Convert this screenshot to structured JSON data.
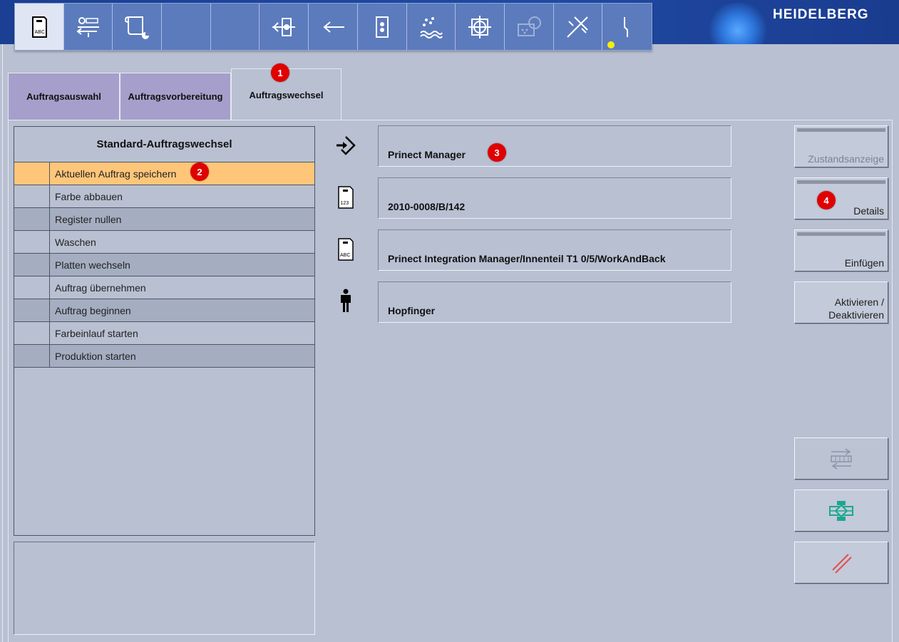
{
  "brand": "HEIDELBERG",
  "toolbar": {
    "buttons": [
      {
        "name": "job-card-abc-icon",
        "active": true
      },
      {
        "name": "feeder-settings-icon",
        "active": false
      },
      {
        "name": "scroll-document-icon",
        "active": false
      },
      {
        "name": "empty-slot-1",
        "active": false
      },
      {
        "name": "empty-slot-2",
        "active": false
      },
      {
        "name": "register-adjust-icon",
        "active": false
      },
      {
        "name": "transfer-arrow-icon",
        "active": false
      },
      {
        "name": "inking-unit-icon",
        "active": false
      },
      {
        "name": "dampening-icon",
        "active": false
      },
      {
        "name": "target-crosshair-icon",
        "active": false
      },
      {
        "name": "quality-control-icon",
        "active": false
      },
      {
        "name": "cross-adjust-icon",
        "active": false
      },
      {
        "name": "power-line-icon",
        "active": false
      }
    ]
  },
  "tabs": [
    {
      "label": "Auftragsauswahl",
      "active": false
    },
    {
      "label": "Auftragsvorbereitung",
      "active": false
    },
    {
      "label": "Auftragswechsel",
      "active": true
    }
  ],
  "badges": [
    "1",
    "2",
    "3",
    "4"
  ],
  "list": {
    "title": "Standard-Auftragswechsel",
    "items": [
      "Aktuellen Auftrag speichern",
      "Farbe abbauen",
      "Register nullen",
      "Waschen",
      "Platten wechseln",
      "Auftrag übernehmen",
      "Auftrag beginnen",
      "Farbeinlauf starten",
      "Produktion starten"
    ],
    "selected_index": 0
  },
  "fields": {
    "source": "Prinect Manager",
    "job_number": "2010-0008/B/142",
    "job_name": "Prinect Integration Manager/Innenteil T1 0/5/WorkAndBack",
    "operator": "Hopfinger"
  },
  "buttons": {
    "status": "Zustandsanzeige",
    "details": "Details",
    "insert": "Einfügen",
    "activate_line1": "Aktivieren /",
    "activate_line2": "Deaktivieren"
  },
  "colors": {
    "selected_row": "#ffc67a",
    "badge": "#e00000",
    "accept_icon": "#1aa88e",
    "cancel_icon": "#e05050",
    "tab_inactive": "#a69fcb"
  }
}
